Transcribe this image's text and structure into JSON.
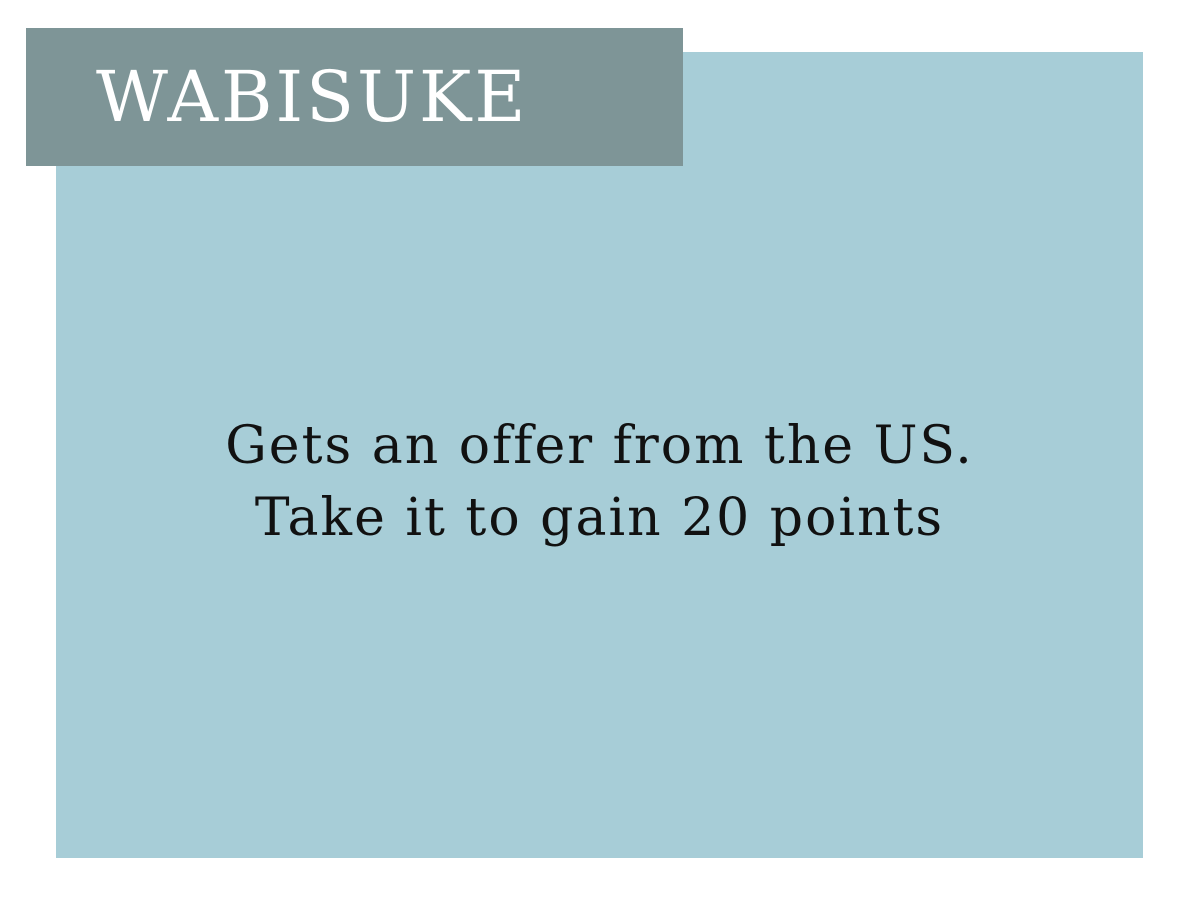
{
  "card": {
    "name": "WABISUKE",
    "text_lines": [
      "Gets an offer from the US.",
      "Take it to gain 20 points"
    ]
  },
  "colors": {
    "card_background": "#a7cdd7",
    "title_banner": "#7e9597",
    "title_text": "#ffffff",
    "body_text": "#111111",
    "page_background": "#ffffff"
  }
}
